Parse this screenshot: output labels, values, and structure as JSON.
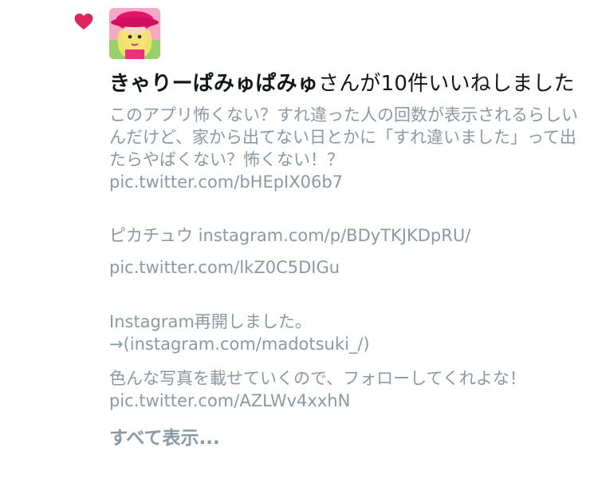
{
  "notification": {
    "type_icon": "heart-icon",
    "accent_color": "#e0245e",
    "avatar_icon": "user-avatar",
    "user_name": "きゃりーぱみゅぱみゅ",
    "action_text": "さんが10件いいねしました"
  },
  "tweets": [
    {
      "text": "このアプリ怖くない？すれ違った人の回数が表示されるらしいんだけど、家から出てない日とかに「すれ違いました」って出たらやばくない？怖くない！？",
      "link": "pic.twitter.com/bHEpIX06b7"
    },
    {
      "text": "ピカチュウ instagram.com/p/BDyTKJKDpRU/",
      "link": "pic.twitter.com/lkZ0C5DIGu"
    },
    {
      "text": "Instagram再開しました。",
      "link": "→(instagram.com/madotsuki_/)",
      "text2": "色んな写真を載せていくので、フォローしてくれよな！",
      "link2": "pic.twitter.com/AZLWv4xxhN"
    }
  ],
  "show_all_label": "すべて表示..."
}
